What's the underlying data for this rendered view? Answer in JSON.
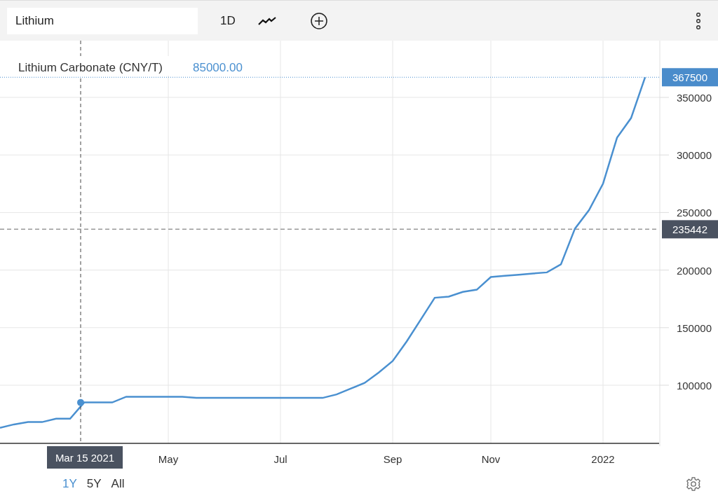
{
  "toolbar": {
    "search": {
      "value": "Lithium"
    },
    "interval": "1D"
  },
  "legend": {
    "name": "Lithium Carbonate (CNY/T)",
    "value": "85000.00"
  },
  "chart": {
    "chart_data": {
      "type": "line",
      "categories": [
        null,
        null,
        null,
        null,
        null,
        null,
        null,
        null,
        null,
        null,
        null,
        null,
        "May",
        null,
        null,
        null,
        null,
        null,
        null,
        null,
        "Jul",
        null,
        null,
        null,
        null,
        null,
        null,
        null,
        "Sep",
        null,
        null,
        null,
        null,
        null,
        null,
        "Nov",
        null,
        null,
        null,
        null,
        null,
        null,
        null,
        "2022",
        null,
        null,
        null
      ],
      "series": [
        {
          "color": "#4a90d0",
          "values": [
            63000,
            66000,
            68000,
            68000,
            71000,
            71000,
            85000,
            85000,
            85000,
            90000,
            90000,
            90000,
            90000,
            90000,
            89000,
            89000,
            89000,
            89000,
            89000,
            89000,
            89000,
            89000,
            89000,
            89000,
            92000,
            97000,
            102000,
            111000,
            121000,
            138000,
            157000,
            176000,
            177000,
            181000,
            183000,
            194000,
            195000,
            196000,
            197000,
            198000,
            205000,
            236000,
            252000,
            275000,
            315000,
            332000,
            367500
          ]
        }
      ],
      "ylim": [
        49500,
        399300
      ],
      "grid": true,
      "ref_lines": [
        {
          "axis": "y",
          "value": 367500,
          "label": "367500",
          "color": "#4a90d0"
        },
        {
          "axis": "y",
          "value": 235442,
          "label": "235442",
          "color": "#999999"
        }
      ],
      "yticks": [
        100000,
        150000,
        200000,
        250000,
        300000,
        350000
      ]
    },
    "crosshair": {
      "date_label": "Mar 15 2021"
    }
  },
  "ranges": [
    {
      "label": "1Y",
      "selected": true
    },
    {
      "label": "5Y",
      "selected": false
    },
    {
      "label": "All",
      "selected": false
    }
  ]
}
